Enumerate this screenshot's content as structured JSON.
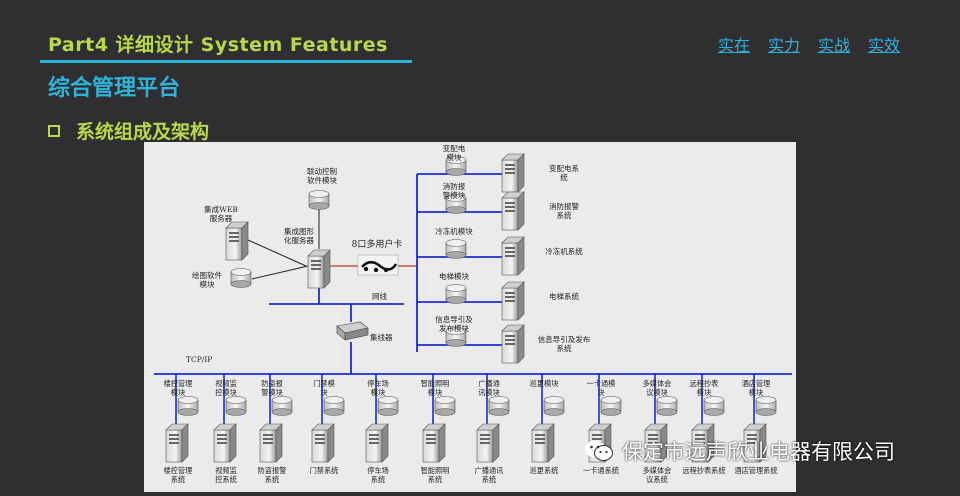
{
  "header": {
    "title": "Part4 详细设计 System Features",
    "slogans": [
      "实在",
      "实力",
      "实战",
      "实效"
    ],
    "subtitle": "综合管理平台",
    "section": "系统组成及架构"
  },
  "diagram": {
    "left": {
      "linkage": "联动控制\n软件模块",
      "web_server": "集成WEB\n服务器",
      "integrated_server": "集成图形\n化服务器",
      "drawing": "绘图软件\n模块",
      "multi_card": "8口多用户卡",
      "network": "网线",
      "hub": "集线器",
      "tcpip": "TCP/IP"
    },
    "right": [
      {
        "module": "变配电\n模块",
        "system": "变配电系\n统"
      },
      {
        "module": "消防报\n警模块",
        "system": "消防报警\n系统"
      },
      {
        "module": "冷冻机模块",
        "system": "冷冻机系统"
      },
      {
        "module": "电梯模块",
        "system": "电梯系统"
      },
      {
        "module": "信息导引及\n发布模块",
        "system": "信息导引及发布\n系统"
      }
    ],
    "bottom": [
      {
        "module": "楼控管理\n模块",
        "system": "楼控管理\n系统"
      },
      {
        "module": "视频监\n控模块",
        "system": "视频监\n控系统"
      },
      {
        "module": "防盗报\n警模块",
        "system": "防盗报警\n系统"
      },
      {
        "module": "门禁模\n块",
        "system": "门禁系统"
      },
      {
        "module": "停车场\n模块",
        "system": "停车场\n系统"
      },
      {
        "module": "智能照明\n模块",
        "system": "智能照明\n系统"
      },
      {
        "module": "广播通\n讯模块",
        "system": "广播通讯\n系统"
      },
      {
        "module": "巡更模块",
        "system": "巡更系统"
      },
      {
        "module": "一卡通模\n块",
        "system": "一卡通系统"
      },
      {
        "module": "多媒体会\n议模块",
        "system": "多媒体会\n议系统"
      },
      {
        "module": "远程抄表\n模块",
        "system": "远程抄表系统"
      },
      {
        "module": "酒店管理\n模块",
        "system": "酒店管理系统"
      }
    ]
  },
  "watermark": "保定市远声欣业电器有限公司",
  "icons": {
    "watermark": "wechat-icon",
    "server": "server-tower-icon",
    "module": "database-cylinder-icon"
  },
  "colors": {
    "accent_green": "#b8d94a",
    "accent_blue": "#2fb3d8",
    "line_blue": "#1e2ad0"
  }
}
